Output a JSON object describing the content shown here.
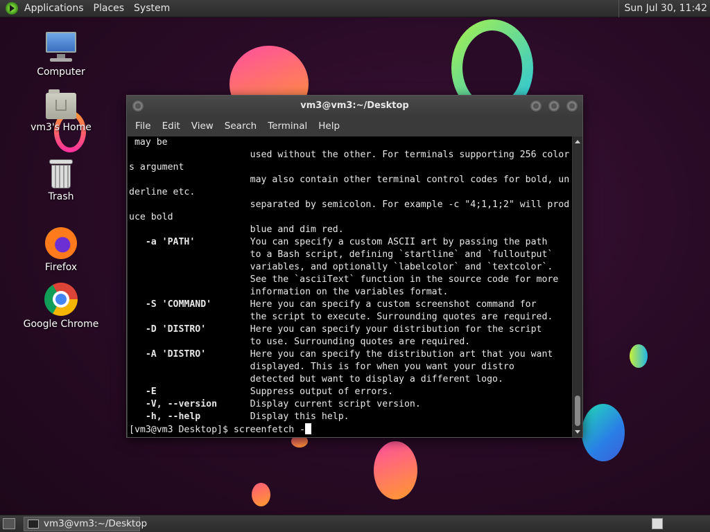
{
  "top_panel": {
    "menus": [
      "Applications",
      "Places",
      "System"
    ],
    "clock": "Sun Jul 30, 11:42"
  },
  "desktop_icons": [
    {
      "label": "Computer",
      "icon": "computer-icon"
    },
    {
      "label": "vm3's Home",
      "icon": "home-folder-icon"
    },
    {
      "label": "Trash",
      "icon": "trash-icon"
    },
    {
      "label": "Firefox",
      "icon": "firefox-icon"
    },
    {
      "label": "Google Chrome",
      "icon": "chrome-icon"
    }
  ],
  "terminal": {
    "title": "vm3@vm3:~/Desktop",
    "menu": [
      "File",
      "Edit",
      "View",
      "Search",
      "Terminal",
      "Help"
    ],
    "lines": [
      " may be",
      "                      used without the other. For terminals supporting 256 color",
      "s argument",
      "                      may also contain other terminal control codes for bold, un",
      "derline etc.",
      "                      separated by semicolon. For example -c \"4;1,1;2\" will prod",
      "uce bold",
      "                      blue and dim red.",
      "   -a 'PATH'          You can specify a custom ASCII art by passing the path",
      "                      to a Bash script, defining `startline` and `fulloutput`",
      "                      variables, and optionally `labelcolor` and `textcolor`.",
      "                      See the `asciiText` function in the source code for more",
      "                      information on the variables format.",
      "   -S 'COMMAND'       Here you can specify a custom screenshot command for",
      "                      the script to execute. Surrounding quotes are required.",
      "   -D 'DISTRO'        Here you can specify your distribution for the script",
      "                      to use. Surrounding quotes are required.",
      "   -A 'DISTRO'        Here you can specify the distribution art that you want",
      "                      displayed. This is for when you want your distro",
      "                      detected but want to display a different logo.",
      "   -E                 Suppress output of errors.",
      "   -V, --version      Display current script version.",
      "   -h, --help         Display this help."
    ],
    "prompt": "[vm3@vm3 Desktop]$ ",
    "input": "screenfetch -"
  },
  "bottom_panel": {
    "task_label": "vm3@vm3:~/Desktop"
  }
}
